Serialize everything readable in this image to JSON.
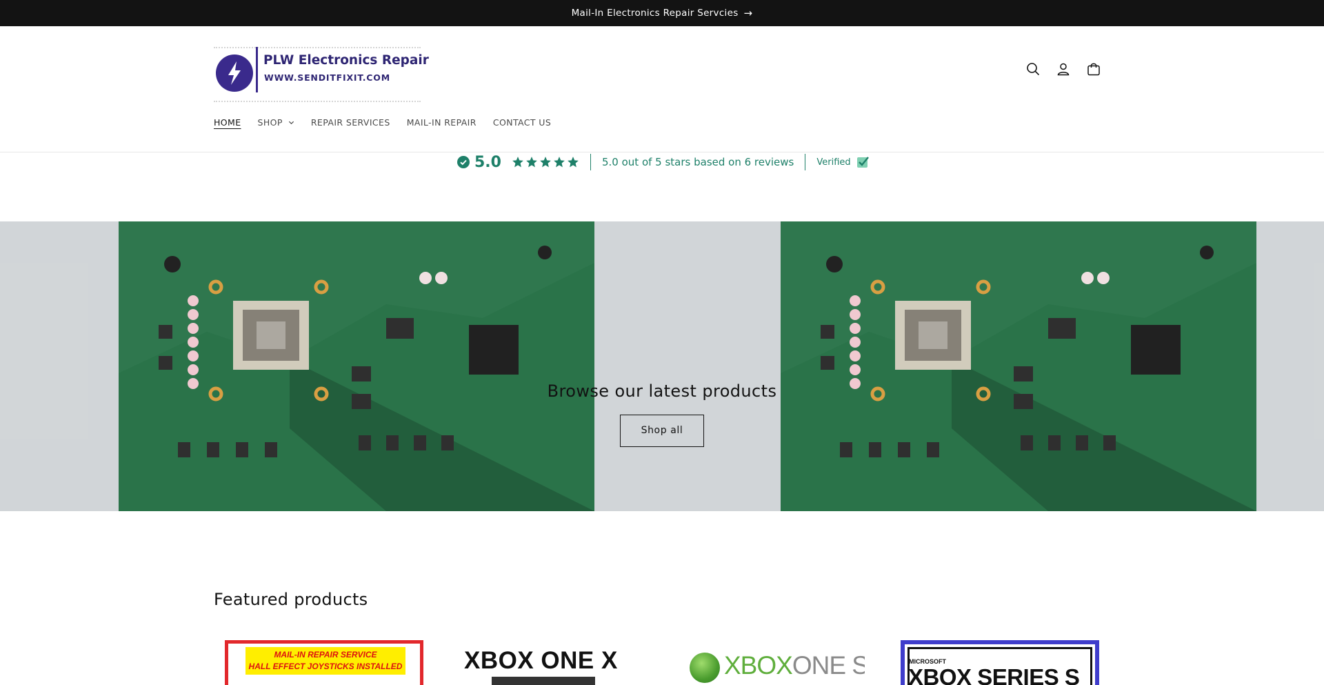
{
  "announcement": {
    "text": "Mail-In Electronics Repair Servcies",
    "arrow_icon": "arrow-right-icon"
  },
  "logo": {
    "name": "PLW Electronics Repair",
    "url": "WWW.SENDITFIXIT.COM",
    "brand_color": "#2e2573"
  },
  "header_icons": [
    "search-icon",
    "account-icon",
    "cart-icon"
  ],
  "nav": {
    "items": [
      {
        "label": "HOME",
        "active": true
      },
      {
        "label": "SHOP",
        "has_dropdown": true
      },
      {
        "label": "REPAIR SERVICES"
      },
      {
        "label": "MAIL-IN REPAIR"
      },
      {
        "label": "CONTACT US"
      }
    ]
  },
  "reviews": {
    "score": "5.0",
    "stars": 5,
    "summary": "5.0 out of 5 stars based on 6 reviews",
    "verified": "Verified",
    "color": "#1e8069"
  },
  "hero": {
    "heading": "Browse our latest products",
    "button": "Shop all"
  },
  "featured": {
    "heading": "Featured products",
    "products": [
      {
        "image_text_1": "MAIL-IN REPAIR SERVICE",
        "image_text_2": "HALL EFFECT JOYSTICKS INSTALLED"
      },
      {
        "image_text": "XBOX ONE X"
      },
      {
        "image_text_1": "XBOX",
        "image_text_2": "ONE S"
      },
      {
        "image_text_small": "MICROSOFT",
        "image_text_big": "XBOX SERIES S"
      }
    ]
  }
}
